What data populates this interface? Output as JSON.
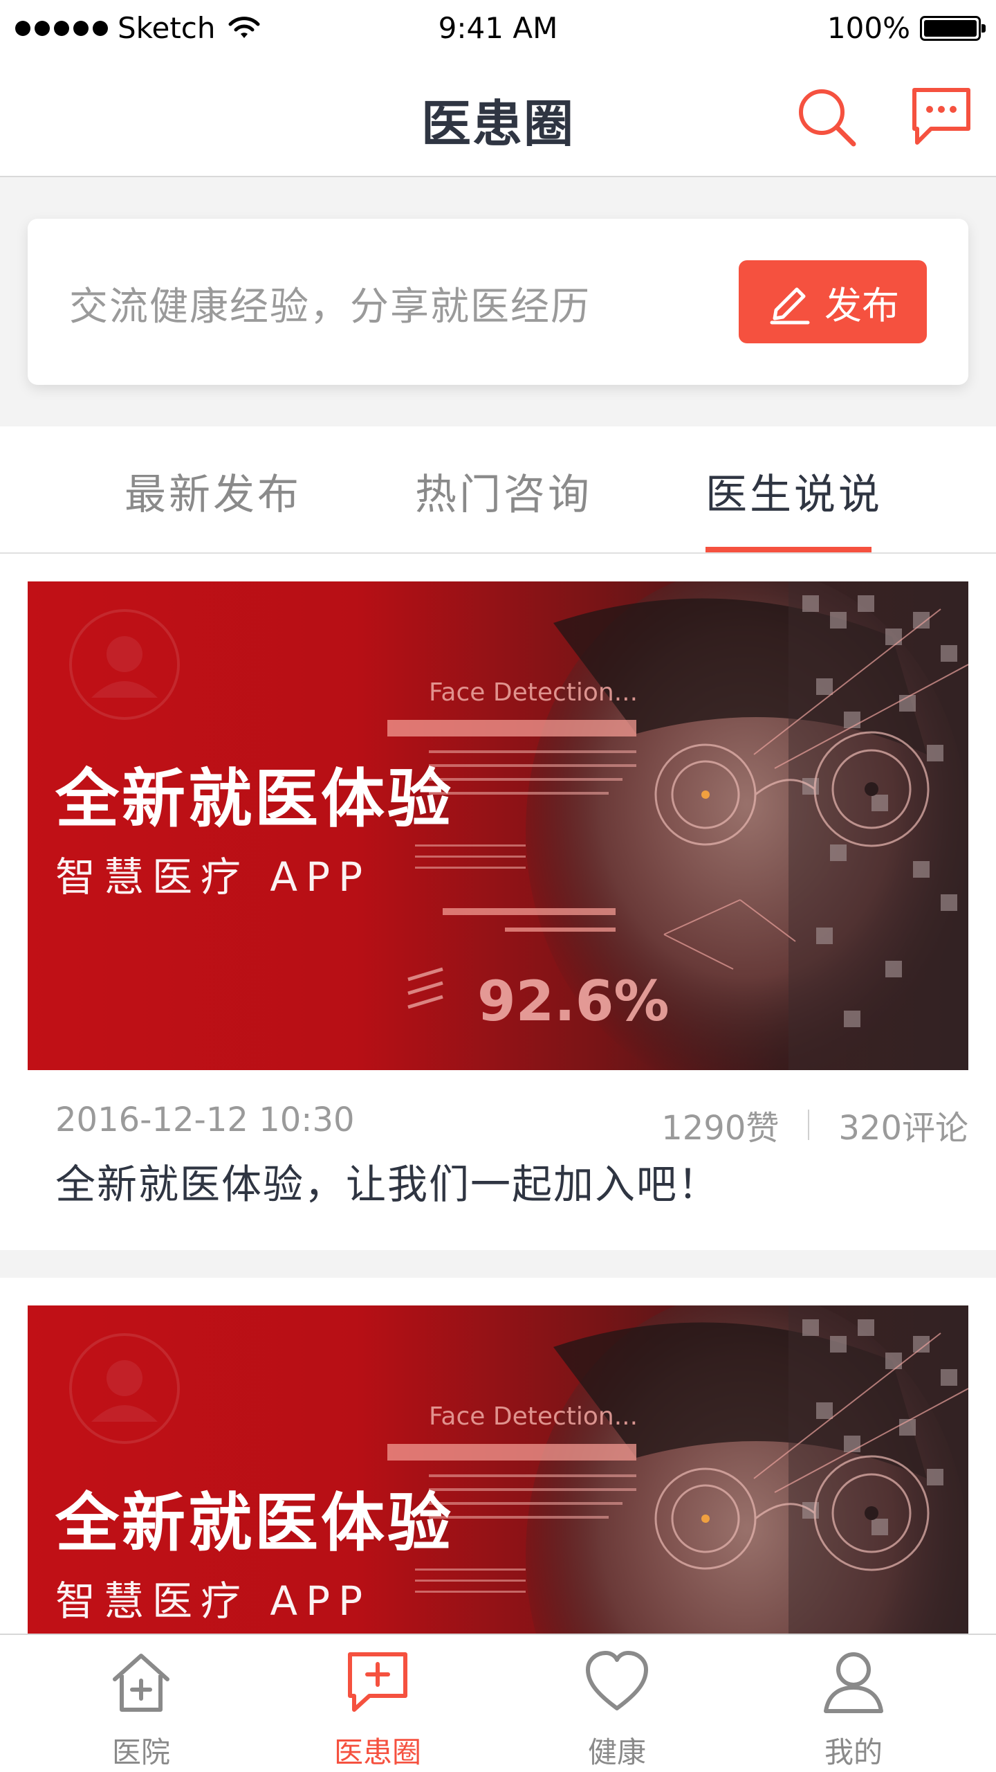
{
  "status": {
    "carrier": "Sketch",
    "time": "9:41 AM",
    "battery": "100%"
  },
  "nav": {
    "title": "医患圈",
    "accent": "#f5513f"
  },
  "composer": {
    "placeholder": "交流健康经验，分享就医经历",
    "publish_label": "发布"
  },
  "tabs": [
    {
      "label": "最新发布"
    },
    {
      "label": "热门咨询"
    },
    {
      "label": "医生说说"
    }
  ],
  "posts": [
    {
      "banner_title": "全新就医体验",
      "banner_sub": "智慧医疗 APP",
      "banner_detect": "Face Detection...",
      "banner_percent": "92.6%",
      "date": "2016-12-12 10:30",
      "likes": "1290赞",
      "comments": "320评论",
      "text": "全新就医体验，让我们一起加入吧！"
    },
    {
      "banner_title": "全新就医体验",
      "banner_sub": "智慧医疗 APP",
      "banner_detect": "Face Detection..."
    }
  ],
  "tabbar": [
    {
      "label": "医院",
      "icon": "house-plus-icon"
    },
    {
      "label": "医患圈",
      "icon": "chat-plus-icon"
    },
    {
      "label": "健康",
      "icon": "heart-icon"
    },
    {
      "label": "我的",
      "icon": "user-icon"
    }
  ]
}
